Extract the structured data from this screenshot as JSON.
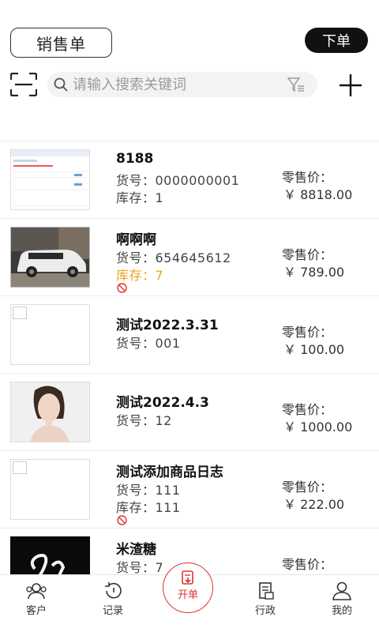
{
  "header": {
    "title": "销售单",
    "order_button": "下单"
  },
  "search": {
    "placeholder": "请输入搜索关键词"
  },
  "products": [
    {
      "name": "8188",
      "line1": "货号：0000000001",
      "line2": "库存：1",
      "price_label": "零售价：",
      "price": "￥ 8818.00",
      "disabled": false
    },
    {
      "name": "啊啊啊",
      "line1": "货号：654645612",
      "line2": "库存：7",
      "price_label": "零售价：",
      "price": "￥ 789.00",
      "disabled": true
    },
    {
      "name": "测试2022.3.31",
      "line1": "货号：001",
      "line2": "",
      "price_label": "零售价：",
      "price": "￥ 100.00",
      "disabled": false
    },
    {
      "name": "测试2022.4.3",
      "line1": "货号：12",
      "line2": "",
      "price_label": "零售价：",
      "price": "￥ 1000.00",
      "disabled": false
    },
    {
      "name": "测试添加商品日志",
      "line1": "货号：111",
      "line2": "库存：111",
      "price_label": "零售价：",
      "price": "￥ 222.00",
      "disabled": true
    },
    {
      "name": "米渣糖",
      "line1": "货号：7",
      "line2": "",
      "price_label": "零售价：",
      "price": "",
      "disabled": false
    }
  ],
  "tabs": {
    "customers": "客户",
    "records": "记录",
    "open_order": "开单",
    "admin": "行政",
    "mine": "我的"
  },
  "colors": {
    "accent": "#d33333",
    "warning": "#f0a020"
  }
}
